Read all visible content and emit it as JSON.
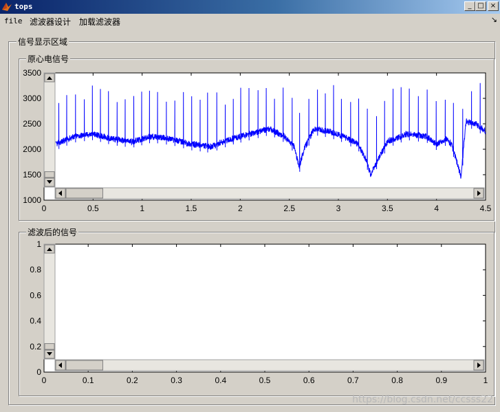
{
  "window": {
    "title": "tops",
    "minimize": "_",
    "maximize": "□",
    "close": "×"
  },
  "menu": {
    "items": [
      "file",
      "滤波器设计",
      "加载滤波器"
    ],
    "arrow": "↘"
  },
  "panel_main": {
    "title": "信号显示区域"
  },
  "panel_original": {
    "title": "原心电信号"
  },
  "panel_filtered": {
    "title": "滤波后的信号"
  },
  "colors": {
    "signal": "#0000ff",
    "frame": "#d4d0c8",
    "title_bar_start": "#0a246a"
  },
  "chart_data": [
    {
      "type": "line",
      "title": "",
      "xlabel": "",
      "ylabel": "",
      "xlim": [
        0,
        4.5
      ],
      "ylim": [
        1000,
        3500
      ],
      "xticks": [
        "0",
        "0.5",
        "1",
        "1.5",
        "2",
        "2.5",
        "3",
        "3.5",
        "4",
        "4.5"
      ],
      "yticks": [
        "1000",
        "1500",
        "2000",
        "2500",
        "3000",
        "3500"
      ],
      "series": [
        {
          "baseline": {
            "x": [
              0.12,
              0.3,
              0.5,
              0.7,
              0.9,
              1.1,
              1.3,
              1.5,
              1.7,
              1.9,
              2.1,
              2.3,
              2.45,
              2.55,
              2.6,
              2.65,
              2.75,
              2.9,
              3.05,
              3.2,
              3.28,
              3.33,
              3.38,
              3.5,
              3.7,
              3.9,
              4.0,
              4.1,
              4.15,
              4.2,
              4.25,
              4.3,
              4.4,
              4.5
            ],
            "y": [
              2100,
              2250,
              2300,
              2200,
              2150,
              2250,
              2200,
              2100,
              2050,
              2200,
              2300,
              2400,
              2250,
              2050,
              1650,
              2000,
              2400,
              2350,
              2250,
              2100,
              1800,
              1500,
              1700,
              2150,
              2300,
              2250,
              2100,
              2200,
              2100,
              1800,
              1450,
              2550,
              2500,
              2350
            ]
          },
          "spike_peak": 3050,
          "spike_period": 0.085,
          "noise_amplitude": 60
        }
      ],
      "scrollbars": {
        "vertical_thumb_fraction": 0.06,
        "horizontal_thumb_fraction": 0.09
      }
    },
    {
      "type": "line",
      "title": "",
      "xlabel": "",
      "ylabel": "",
      "xlim": [
        0,
        1
      ],
      "ylim": [
        0,
        1
      ],
      "xticks": [
        "0",
        "0.1",
        "0.2",
        "0.3",
        "0.4",
        "0.5",
        "0.6",
        "0.7",
        "0.8",
        "0.9",
        "1"
      ],
      "yticks": [
        "0",
        "0.2",
        "0.4",
        "0.6",
        "0.8",
        "1"
      ],
      "series": [],
      "scrollbars": {
        "vertical_thumb_fraction": 0.06,
        "horizontal_thumb_fraction": 0.09
      }
    }
  ],
  "watermark": "https://blog.csdn.net/ccsss22"
}
